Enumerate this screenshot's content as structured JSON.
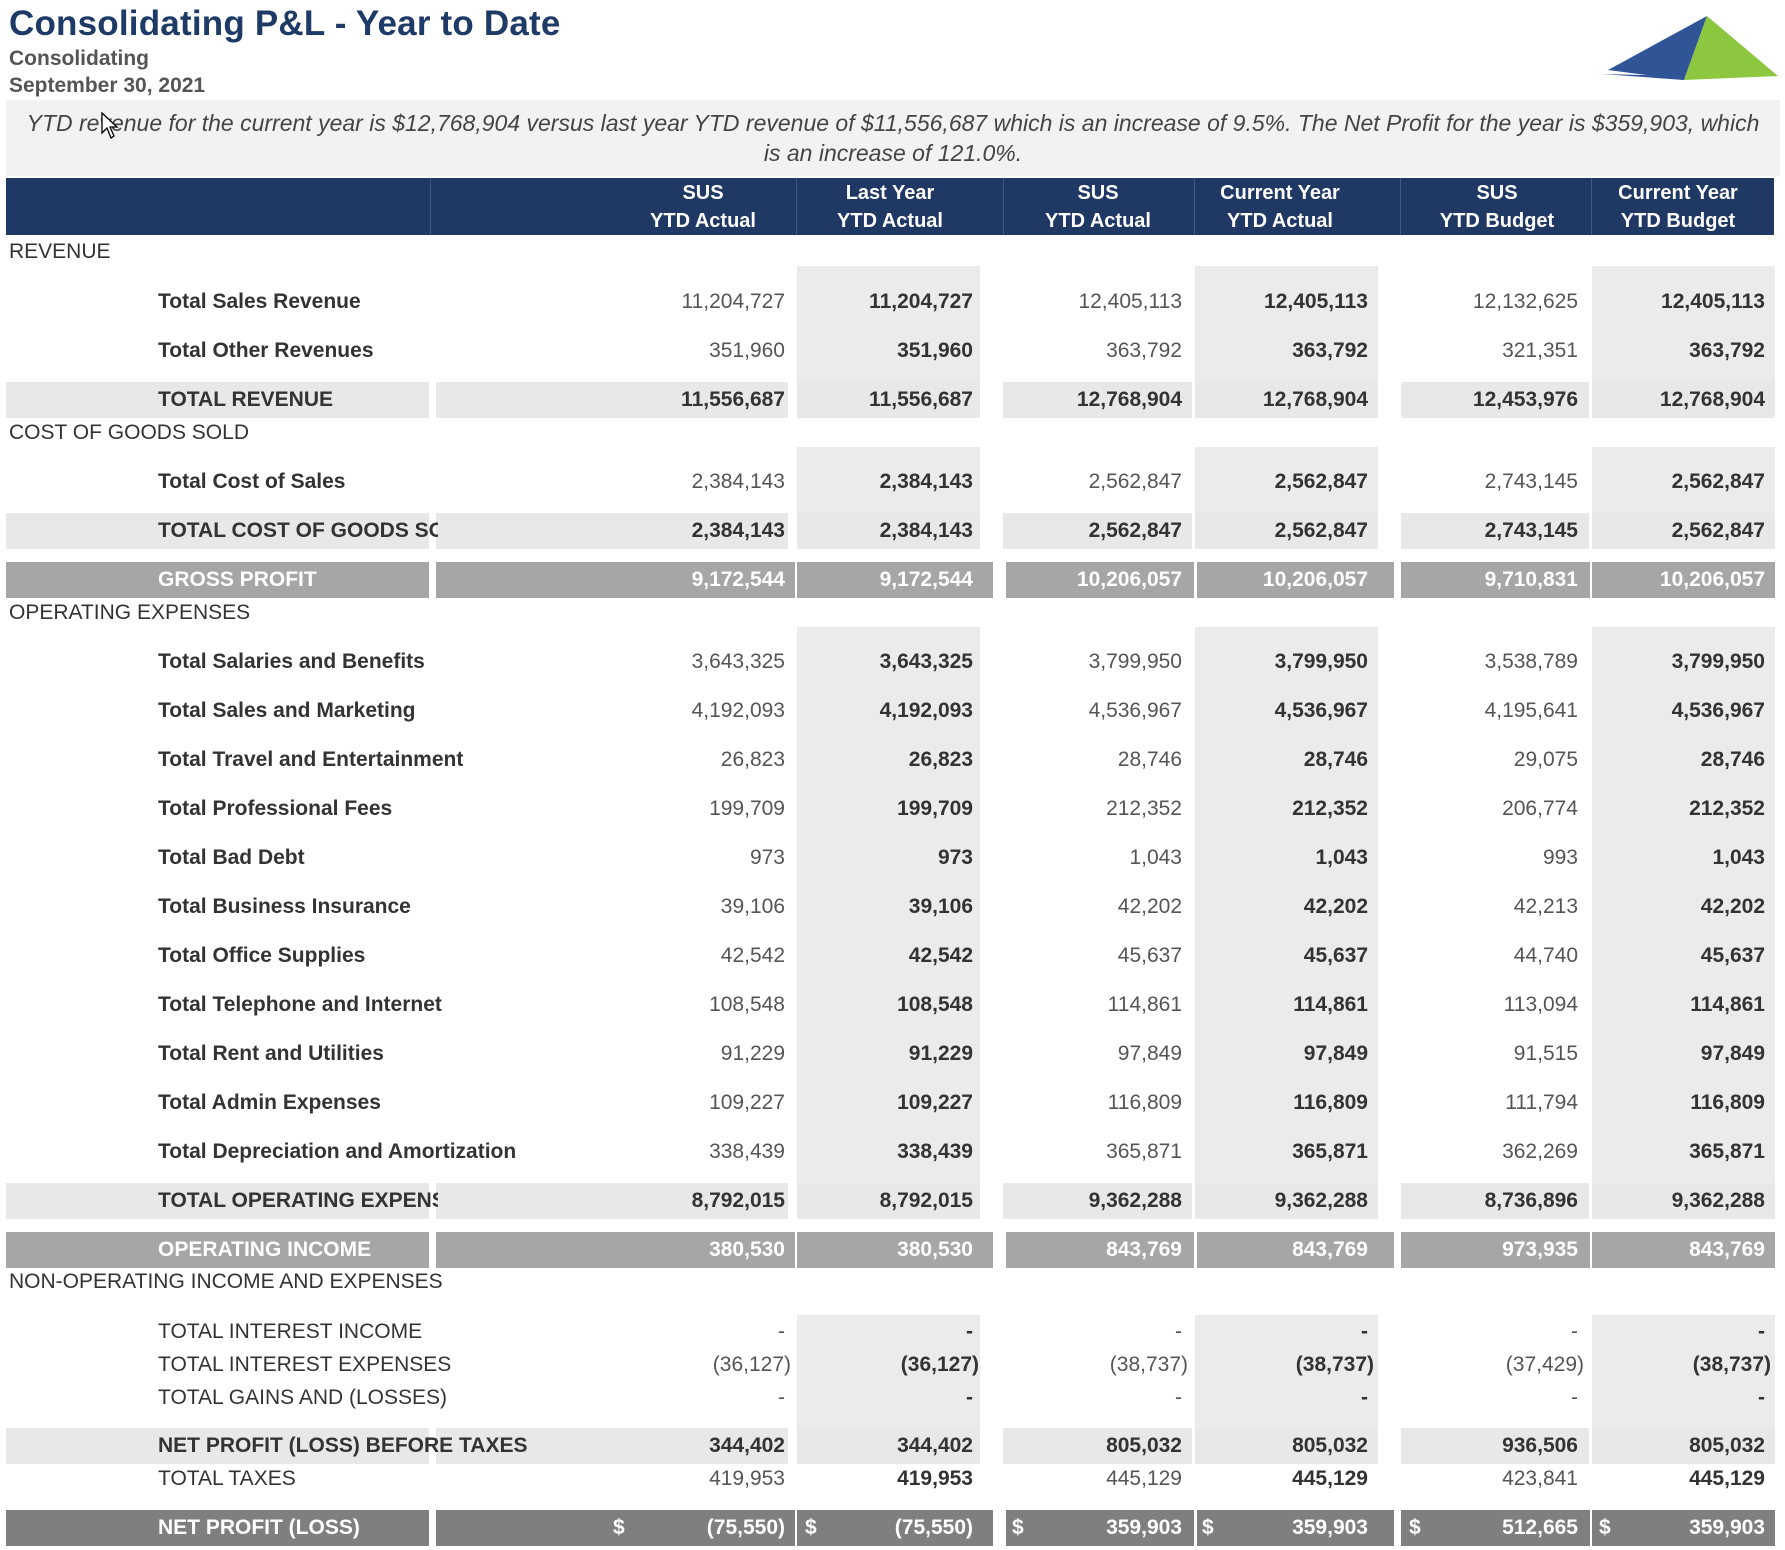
{
  "report": {
    "title": "Consolidating P&L - Year to Date",
    "entity": "Consolidating",
    "date": "September 30, 2021",
    "summary": "YTD revenue for the current year is $12,768,904 versus last year YTD revenue of $11,556,687 which is an increase of 9.5%.  The Net Profit for the year is $359,903, which is an increase of 121.0%."
  },
  "columns": [
    {
      "line1": "SUS",
      "line2": "YTD Actual"
    },
    {
      "line1": "Last Year",
      "line2": "YTD Actual"
    },
    {
      "line1": "SUS",
      "line2": "YTD Actual"
    },
    {
      "line1": "Current Year",
      "line2": "YTD Actual"
    },
    {
      "line1": "SUS",
      "line2": "YTD Budget"
    },
    {
      "line1": "Current Year",
      "line2": "YTD Budget"
    }
  ],
  "sections": {
    "revenue": "REVENUE",
    "cogs": "COST OF GOODS SOLD",
    "opex": "OPERATING EXPENSES",
    "nonop": "NON-OPERATING INCOME AND EXPENSES"
  },
  "rows": [
    {
      "label": "Total Sales Revenue",
      "v": [
        "11,204,727",
        "11,204,727",
        "12,405,113",
        "12,405,113",
        "12,132,625",
        "12,405,113"
      ]
    },
    {
      "label": "Total Other Revenues",
      "v": [
        "351,960",
        "351,960",
        "363,792",
        "363,792",
        "321,351",
        "363,792"
      ]
    },
    {
      "label": "TOTAL REVENUE",
      "v": [
        "11,556,687",
        "11,556,687",
        "12,768,904",
        "12,768,904",
        "12,453,976",
        "12,768,904"
      ]
    },
    {
      "label": "Total Cost of Sales",
      "v": [
        "2,384,143",
        "2,384,143",
        "2,562,847",
        "2,562,847",
        "2,743,145",
        "2,562,847"
      ]
    },
    {
      "label": "TOTAL COST OF GOODS SOLD",
      "v": [
        "2,384,143",
        "2,384,143",
        "2,562,847",
        "2,562,847",
        "2,743,145",
        "2,562,847"
      ]
    },
    {
      "label": "GROSS PROFIT",
      "v": [
        "9,172,544",
        "9,172,544",
        "10,206,057",
        "10,206,057",
        "9,710,831",
        "10,206,057"
      ]
    },
    {
      "label": "Total Salaries and Benefits",
      "v": [
        "3,643,325",
        "3,643,325",
        "3,799,950",
        "3,799,950",
        "3,538,789",
        "3,799,950"
      ]
    },
    {
      "label": "Total Sales and Marketing",
      "v": [
        "4,192,093",
        "4,192,093",
        "4,536,967",
        "4,536,967",
        "4,195,641",
        "4,536,967"
      ]
    },
    {
      "label": "Total Travel and Entertainment",
      "v": [
        "26,823",
        "26,823",
        "28,746",
        "28,746",
        "29,075",
        "28,746"
      ]
    },
    {
      "label": "Total Professional Fees",
      "v": [
        "199,709",
        "199,709",
        "212,352",
        "212,352",
        "206,774",
        "212,352"
      ]
    },
    {
      "label": "Total Bad Debt",
      "v": [
        "973",
        "973",
        "1,043",
        "1,043",
        "993",
        "1,043"
      ]
    },
    {
      "label": "Total Business Insurance",
      "v": [
        "39,106",
        "39,106",
        "42,202",
        "42,202",
        "42,213",
        "42,202"
      ]
    },
    {
      "label": "Total Office Supplies",
      "v": [
        "42,542",
        "42,542",
        "45,637",
        "45,637",
        "44,740",
        "45,637"
      ]
    },
    {
      "label": "Total Telephone and Internet",
      "v": [
        "108,548",
        "108,548",
        "114,861",
        "114,861",
        "113,094",
        "114,861"
      ]
    },
    {
      "label": "Total Rent and Utilities",
      "v": [
        "91,229",
        "91,229",
        "97,849",
        "97,849",
        "91,515",
        "97,849"
      ]
    },
    {
      "label": "Total Admin Expenses",
      "v": [
        "109,227",
        "109,227",
        "116,809",
        "116,809",
        "111,794",
        "116,809"
      ]
    },
    {
      "label": "Total Depreciation and Amortization",
      "v": [
        "338,439",
        "338,439",
        "365,871",
        "365,871",
        "362,269",
        "365,871"
      ]
    },
    {
      "label": "TOTAL OPERATING EXPENSES",
      "v": [
        "8,792,015",
        "8,792,015",
        "9,362,288",
        "9,362,288",
        "8,736,896",
        "9,362,288"
      ]
    },
    {
      "label": "OPERATING INCOME",
      "v": [
        "380,530",
        "380,530",
        "843,769",
        "843,769",
        "973,935",
        "843,769"
      ]
    },
    {
      "label": "TOTAL INTEREST INCOME",
      "v": [
        "-",
        "-",
        "-",
        "-",
        "-",
        "-"
      ]
    },
    {
      "label": "TOTAL INTEREST EXPENSES",
      "v": [
        "(36,127)",
        "(36,127)",
        "(38,737)",
        "(38,737)",
        "(37,429)",
        "(38,737)"
      ]
    },
    {
      "label": "TOTAL GAINS AND (LOSSES)",
      "v": [
        "-",
        "-",
        "-",
        "-",
        "-",
        "-"
      ]
    },
    {
      "label": "NET PROFIT (LOSS) BEFORE TAXES",
      "v": [
        "344,402",
        "344,402",
        "805,032",
        "805,032",
        "936,506",
        "805,032"
      ]
    },
    {
      "label": "TOTAL TAXES",
      "v": [
        "419,953",
        "419,953",
        "445,129",
        "445,129",
        "423,841",
        "445,129"
      ]
    },
    {
      "label": "NET PROFIT (LOSS)",
      "currency": "$",
      "v": [
        "(75,550)",
        "(75,550)",
        "359,903",
        "359,903",
        "512,665",
        "359,903"
      ]
    }
  ],
  "colors": {
    "header": "#1f3864",
    "title": "#1e3a66",
    "logo_blue": "#2f5597",
    "logo_green": "#8dc63f"
  },
  "icons": {
    "logo": "mountain-logo-icon",
    "cursor": "mouse-pointer-icon"
  }
}
